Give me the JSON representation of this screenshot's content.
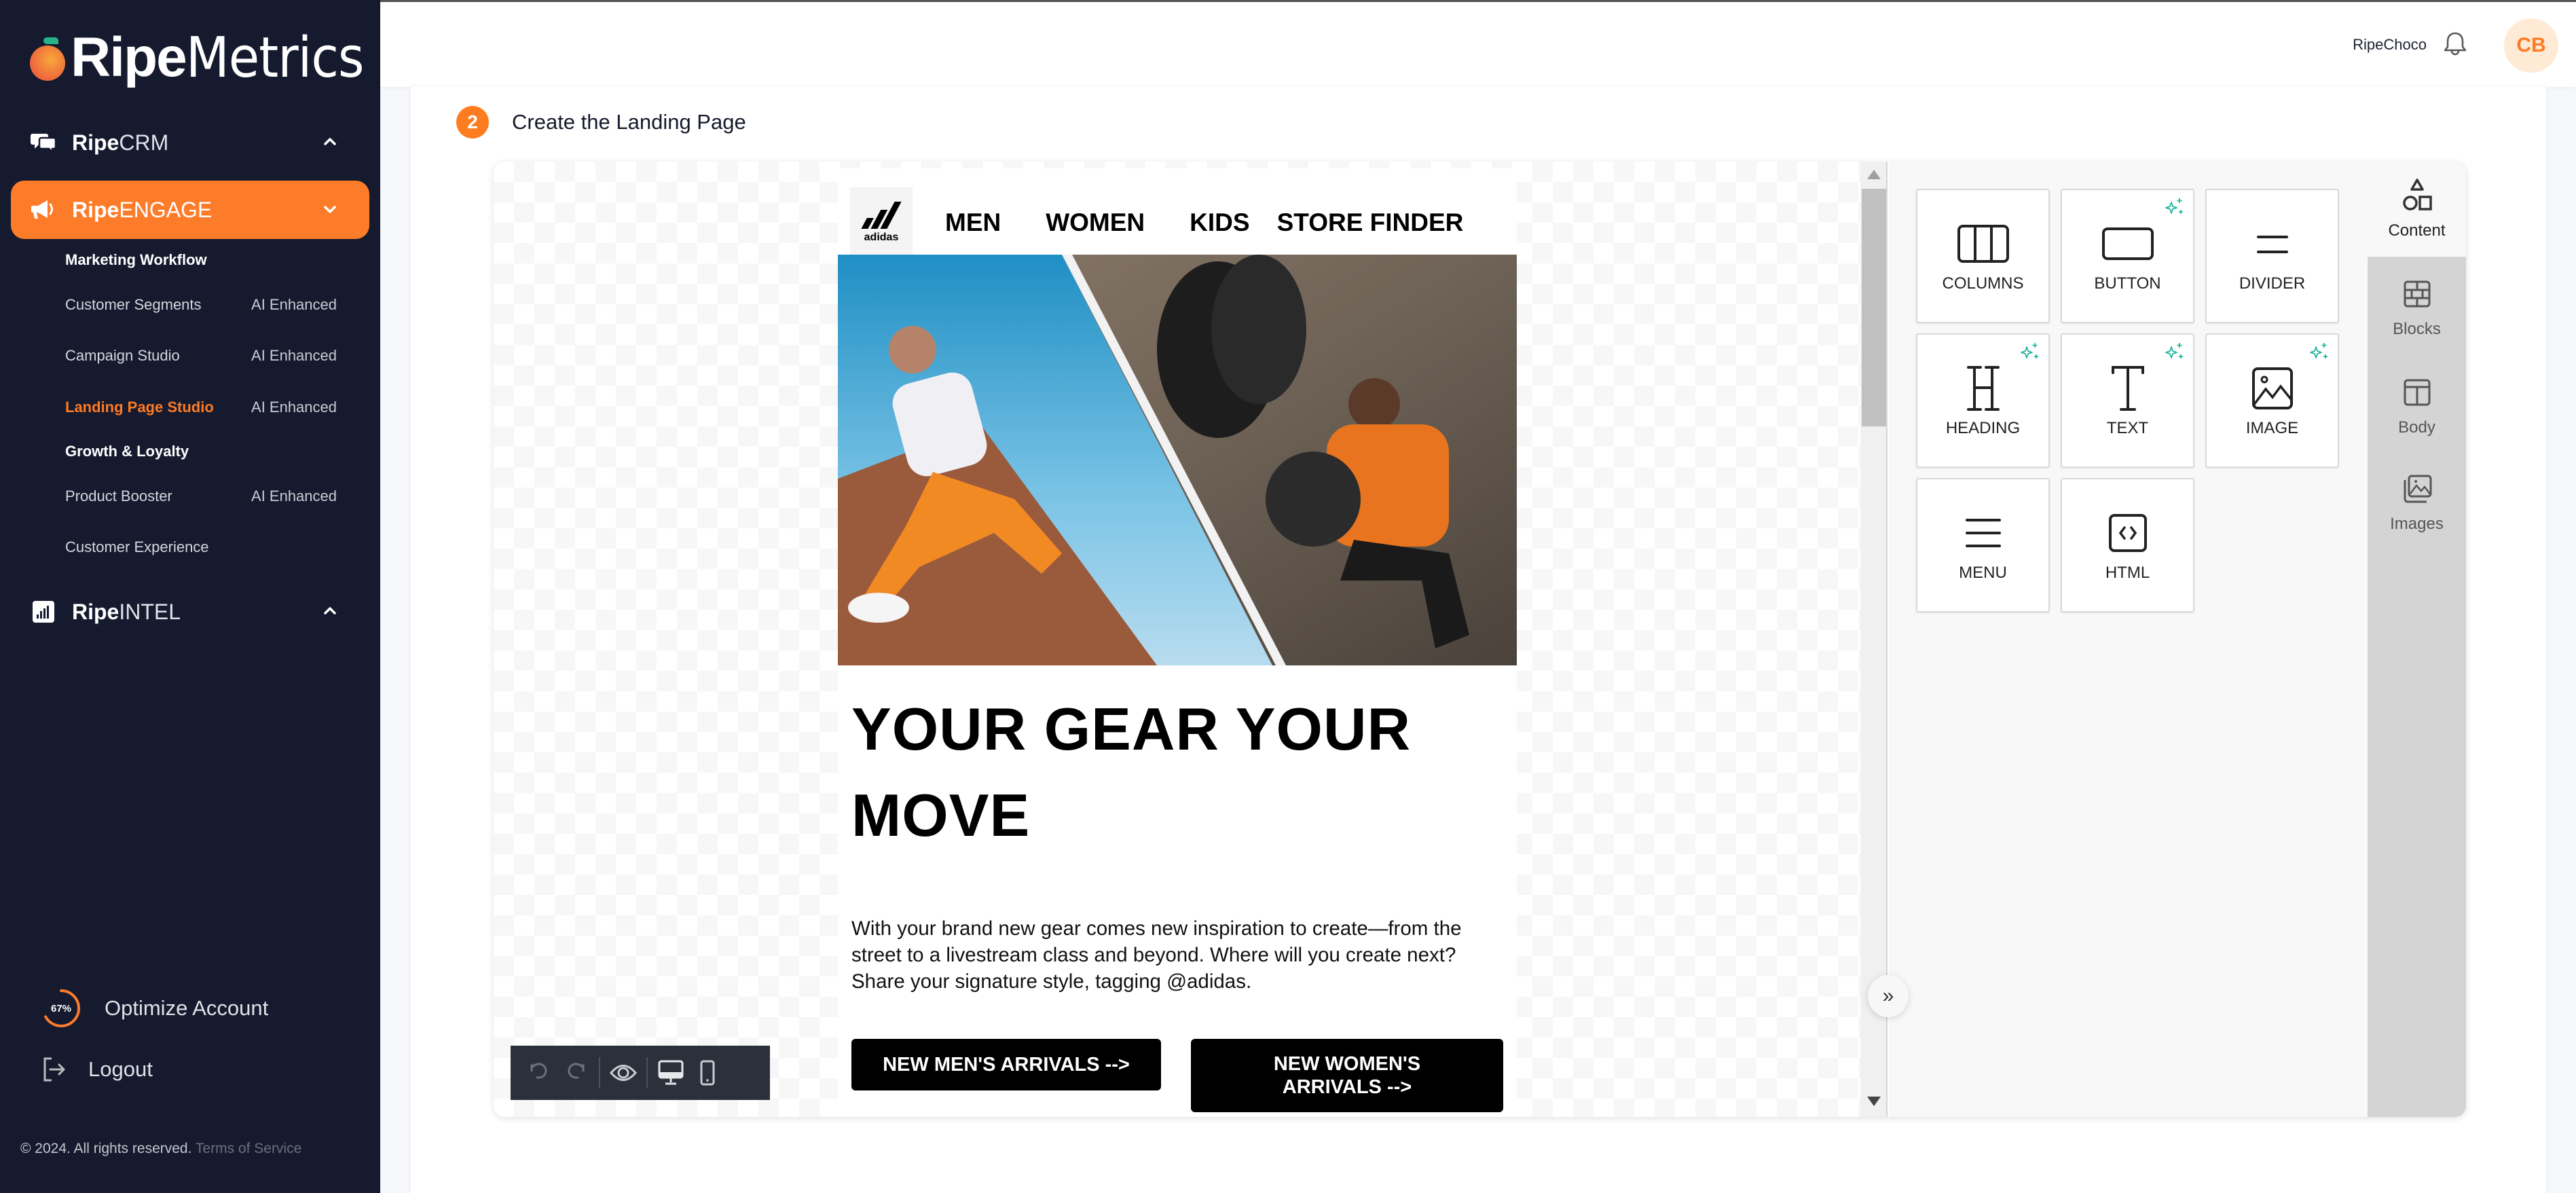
{
  "brand": {
    "ripe": "Ripe",
    "metrics": "Metrics"
  },
  "sidebar": {
    "groups": [
      {
        "bold": "Ripe",
        "light": "CRM",
        "icon": "chat-bubbles-icon",
        "expanded": false
      },
      {
        "bold": "Ripe",
        "light": "ENGAGE",
        "icon": "megaphone-icon",
        "expanded": true,
        "active": true
      },
      {
        "bold": "Ripe",
        "light": "INTEL",
        "icon": "bar-chart-icon",
        "expanded": false
      }
    ],
    "engage_sections": [
      {
        "title": "Marketing Workflow",
        "items": [
          {
            "label": "Customer Segments",
            "tag": "AI Enhanced"
          },
          {
            "label": "Campaign Studio",
            "tag": "AI Enhanced"
          },
          {
            "label": "Landing Page Studio",
            "tag": "AI Enhanced",
            "active": true
          }
        ]
      },
      {
        "title": "Growth & Loyalty",
        "items": [
          {
            "label": "Product Booster",
            "tag": "AI Enhanced"
          },
          {
            "label": "Customer Experience",
            "tag": ""
          }
        ]
      }
    ],
    "optimize": {
      "label": "Optimize Account",
      "percent_text": "67%",
      "progress": 0.67
    },
    "logout_label": "Logout",
    "copyright": "© 2024. All rights reserved.",
    "terms_label": "Terms of Service"
  },
  "header": {
    "user_name": "RipeChoco",
    "avatar_initials": "CB"
  },
  "step": {
    "number": "2",
    "title": "Create the Landing Page"
  },
  "landing_page": {
    "logo_text": "adidas",
    "nav": [
      "MEN",
      "WOMEN",
      "KIDS",
      "STORE FINDER"
    ],
    "heading": "YOUR GEAR YOUR MOVE",
    "body": "With your brand new gear comes new inspiration to create—from the street to a livestream class and beyond. Where will you create next? Share your signature style, tagging @adidas.",
    "buttons": [
      "NEW MEN'S ARRIVALS -->",
      "NEW WOMEN'S ARRIVALS -->"
    ]
  },
  "toolbar": {
    "undo": "undo-icon",
    "redo": "redo-icon",
    "preview": "eye-icon",
    "desktop": "desktop-icon",
    "mobile": "mobile-icon"
  },
  "tools": [
    {
      "label": "COLUMNS",
      "icon": "columns-icon",
      "ai": false
    },
    {
      "label": "BUTTON",
      "icon": "button-icon",
      "ai": true
    },
    {
      "label": "DIVIDER",
      "icon": "divider-icon",
      "ai": false
    },
    {
      "label": "HEADING",
      "icon": "heading-icon",
      "ai": true
    },
    {
      "label": "TEXT",
      "icon": "text-icon",
      "ai": true
    },
    {
      "label": "IMAGE",
      "icon": "image-icon",
      "ai": true
    },
    {
      "label": "MENU",
      "icon": "menu-icon",
      "ai": false
    },
    {
      "label": "HTML",
      "icon": "html-icon",
      "ai": false
    }
  ],
  "tabs": [
    {
      "label": "Content",
      "icon": "shapes-icon",
      "active": true
    },
    {
      "label": "Blocks",
      "icon": "blocks-icon"
    },
    {
      "label": "Body",
      "icon": "body-layout-icon"
    },
    {
      "label": "Images",
      "icon": "images-icon"
    }
  ],
  "colors": {
    "accent": "#fd7c2a",
    "sidebar_bg": "#151a2e",
    "ai_sparkle": "#26b59a"
  }
}
